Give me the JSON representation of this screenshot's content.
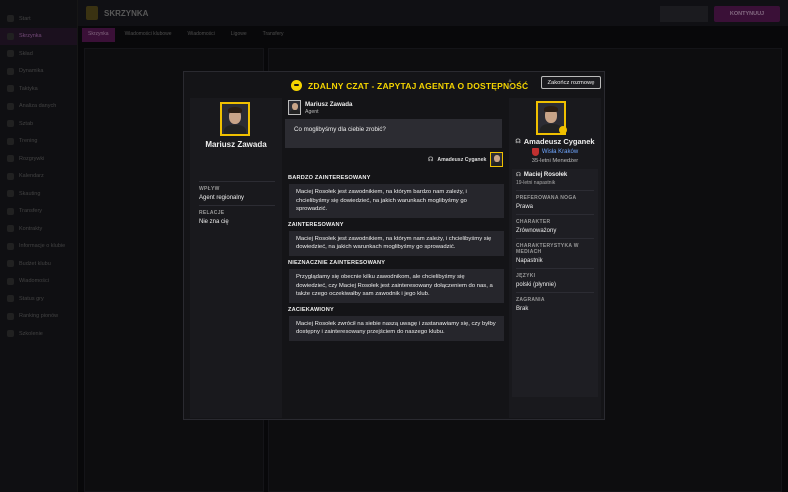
{
  "modal": {
    "title": "ZDALNY CZAT - ZAPYTAJ AGENTA O DOSTĘPNOŚĆ",
    "end_button": "Zakończ rozmowę",
    "colors": {
      "accent": "#f4d400",
      "panel": "#19191d",
      "option_bg": "#26262c"
    }
  },
  "agent": {
    "name": "Mariusz Zawada",
    "role": "Agent",
    "fields": [
      {
        "label": "WPŁYW",
        "value": "Agent regionalny"
      },
      {
        "label": "RELACJE",
        "value": "Nie zna cię"
      }
    ]
  },
  "chat": {
    "question": "Co moglibyśmy dla ciebie zrobić?",
    "you_name": "Amadeusz Cyganek",
    "options": [
      {
        "label": "BARDZO ZAINTERESOWANY",
        "text": "Maciej Rosołek jest zawodnikiem, na którym bardzo nam zależy, i chcielibyśmy się dowiedzieć, na jakich warunkach moglibyśmy go sprowadzić."
      },
      {
        "label": "ZAINTERESOWANY",
        "text": "Maciej Rosołek jest zawodnikiem, na którym nam zależy, i chcielibyśmy się dowiedzieć, na jakich warunkach moglibyśmy go sprowadzić."
      },
      {
        "label": "NIEZNACZNIE ZAINTERESOWANY",
        "text": "Przyglądamy się obecnie kilku zawodnikom, ale chcielibyśmy się dowiedzieć, czy Maciej Rosołek jest zainteresowany dołączeniem do nas, a także czego oczekiwałby sam zawodnik i jego klub."
      },
      {
        "label": "ZACIEKAWIONY",
        "text": "Maciej Rosołek zwrócił na siebie naszą uwagę i zastanawiamy się, czy byłby dostępny i zainteresowany przejściem do naszego klubu."
      }
    ]
  },
  "manager": {
    "name": "Amadeusz Cyganek",
    "club": "Wisła Kraków",
    "description": "35-letni Menedżer"
  },
  "player": {
    "name": "Maciej Rosołek",
    "sub": "19-letni napastnik",
    "fields": [
      {
        "label": "PREFEROWANA NOGA",
        "value": "Prawa"
      },
      {
        "label": "CHARAKTER",
        "value": "Zrównoważony"
      },
      {
        "label": "CHARAKTERYSTYKA W MEDIACH",
        "value": "Napastnik"
      },
      {
        "label": "JĘZYKI",
        "value": "polski (płynnie)"
      },
      {
        "label": "ZAGRANIA",
        "value": "Brak"
      }
    ]
  },
  "background": {
    "header_title": "SKRZYNKA",
    "continue_label": "KONTYNUUJ",
    "tabs": [
      "Skrzynka",
      "Wiadomości klubowe",
      "Wiadomości",
      "Ligowe",
      "Transfery"
    ],
    "sidebar": [
      "Start",
      "Skrzynka",
      "Skład",
      "Dynamika",
      "Taktyka",
      "Analiza danych",
      "Sztab",
      "Trening",
      "Rozgrywki",
      "Kalendarz",
      "Skauting",
      "Transfery",
      "Kontrakty",
      "Informacje o klubie",
      "Budżet klubu",
      "Wiadomości",
      "Status gry",
      "Ranking pionów",
      "Szkolenie"
    ]
  }
}
